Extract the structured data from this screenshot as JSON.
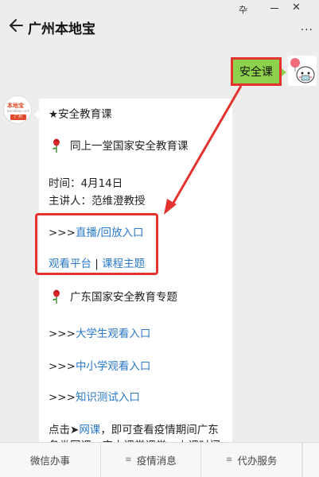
{
  "status": {
    "glyph": "卆",
    "close_glyph": "✕"
  },
  "header": {
    "title": "广州本地宝",
    "more": "···"
  },
  "user_message": {
    "text": "安全课"
  },
  "bot_avatar": {
    "line1": "本地宝",
    "line2": "bendibao.com",
    "line3": "广州"
  },
  "card": {
    "heading": "★安全教育课",
    "item1": "同上一堂国家安全教育课",
    "time": "时间：4月14日",
    "speaker": "主讲人：范维澄教授",
    "live_prefix": ">>>",
    "live_link": "直播/回放入口",
    "platform_link": "观看平台",
    "separator": " | ",
    "topic_link": "课程主题",
    "item2": "广东国家安全教育专题",
    "uni_prefix": ">>>",
    "uni_link": "大学生观看入口",
    "school_prefix": ">>>",
    "school_link": "中小学观看入口",
    "quiz_prefix": ">>>",
    "quiz_link": "知识测试入口",
    "click_prefix": "点击➤",
    "click_link": "网课",
    "click_suffix": "，即可查看疫情期间广东",
    "cutoff_line": "各类网课，空中课堂课堂，上课时间"
  },
  "menu": [
    {
      "label": "微信办事",
      "icon": ""
    },
    {
      "label": "疫情消息",
      "icon": "≡"
    },
    {
      "label": "代办服务",
      "icon": "≡"
    }
  ],
  "colors": {
    "accent_red": "#e4332f",
    "bubble_green": "#8ed14c",
    "link_blue": "#2b79c8"
  }
}
